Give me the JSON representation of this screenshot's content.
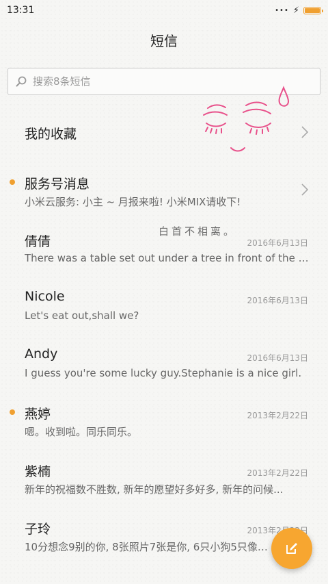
{
  "status": {
    "time": "13:31"
  },
  "header": {
    "title": "短信"
  },
  "search": {
    "placeholder": "搜索8条短信"
  },
  "favorites": {
    "label": "我的收藏"
  },
  "service": {
    "label": "服务号消息",
    "preview": "小米云服务: 小主 ~ 月报来啦! 小米MIX请收下!"
  },
  "decor": {
    "handwriting": "白首不相离。"
  },
  "messages": [
    {
      "name": "倩倩",
      "date": "2016年6月13日",
      "preview": "There was a table set out under a tree in front of the ho...",
      "unread": false
    },
    {
      "name": "Nicole",
      "date": "2016年6月13日",
      "preview": "Let's eat out,shall we?",
      "unread": false
    },
    {
      "name": "Andy",
      "date": "2016年6月13日",
      "preview": "I guess you're some lucky guy.Stephanie is a nice girl.",
      "unread": false
    },
    {
      "name": "燕婷",
      "date": "2013年2月22日",
      "preview": "嗯。收到啦。同乐同乐。",
      "unread": true
    },
    {
      "name": "紫楠",
      "date": "2013年2月22日",
      "preview": "新年的祝福数不胜数, 新年的愿望好多好多, 新年的问候...",
      "unread": false
    },
    {
      "name": "子玲",
      "date": "2013年2月22日",
      "preview": "10分想念9别的你, 8张照片7张是你, 6只小狗5只像你...",
      "unread": false
    }
  ],
  "colors": {
    "accent": "#f7a630",
    "doodle": "#e8508a"
  }
}
